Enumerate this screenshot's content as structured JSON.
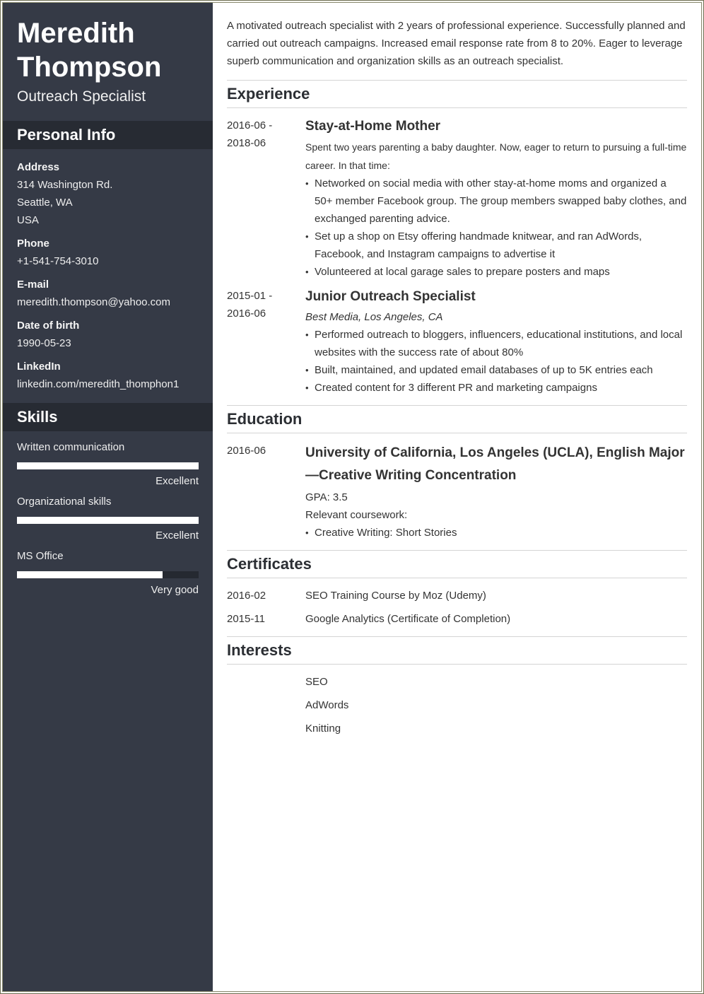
{
  "profile": {
    "name_first": "Meredith",
    "name_last": "Thompson",
    "title": "Outreach Specialist"
  },
  "sidebar": {
    "personal_info_heading": "Personal Info",
    "address_label": "Address",
    "address_lines": [
      "314 Washington Rd.",
      "Seattle, WA",
      "USA"
    ],
    "phone_label": "Phone",
    "phone": "+1-541-754-3010",
    "email_label": "E-mail",
    "email": "meredith.thompson@yahoo.com",
    "dob_label": "Date of birth",
    "dob": "1990-05-23",
    "linkedin_label": "LinkedIn",
    "linkedin": "linkedin.com/meredith_thomphon1",
    "skills_heading": "Skills",
    "skills": [
      {
        "name": "Written communication",
        "level": "Excellent",
        "fill_percent": 100
      },
      {
        "name": "Organizational skills",
        "level": "Excellent",
        "fill_percent": 100
      },
      {
        "name": "MS Office",
        "level": "Very good",
        "fill_percent": 80
      }
    ]
  },
  "main": {
    "summary": "A motivated outreach specialist with 2 years of professional experience. Successfully planned and carried out outreach campaigns. Increased email response rate from 8 to 20%. Eager to leverage superb communication and organization skills as an outreach specialist.",
    "experience_heading": "Experience",
    "experience": [
      {
        "date_start": "2016-06 -",
        "date_end": "2018-06",
        "title": "Stay-at-Home Mother",
        "description": "Spent two years parenting a baby daughter. Now, eager to return to pursuing a full-time career. In that time:",
        "bullets": [
          "Networked on social media with other stay-at-home moms and organized a 50+ member Facebook group. The group members swapped baby clothes, and exchanged parenting advice.",
          "Set up a shop on Etsy offering handmade knitwear, and ran AdWords, Facebook, and Instagram campaigns to advertise it",
          "Volunteered at local garage sales to prepare posters and maps"
        ]
      },
      {
        "date_start": "2015-01 -",
        "date_end": "2016-06",
        "title": "Junior Outreach Specialist",
        "company": "Best Media, Los Angeles, CA",
        "bullets": [
          "Performed outreach to bloggers, influencers, educational institutions, and local websites with the success rate of about 80%",
          "Built, maintained, and updated email databases of up to 5K entries each",
          "Created content for 3 different PR and marketing campaigns"
        ]
      }
    ],
    "education_heading": "Education",
    "education": {
      "date": "2016-06",
      "title": "University of California, Los Angeles (UCLA), English Major—Creative Writing Concentration",
      "gpa": "GPA: 3.5",
      "coursework_label": "Relevant coursework:",
      "coursework": [
        "Creative Writing: Short Stories"
      ]
    },
    "certificates_heading": "Certificates",
    "certificates": [
      {
        "date": "2016-02",
        "name": "SEO Training Course by Moz (Udemy)"
      },
      {
        "date": "2015-11",
        "name": "Google Analytics (Certificate of Completion)"
      }
    ],
    "interests_heading": "Interests",
    "interests": [
      "SEO",
      "AdWords",
      "Knitting"
    ]
  }
}
